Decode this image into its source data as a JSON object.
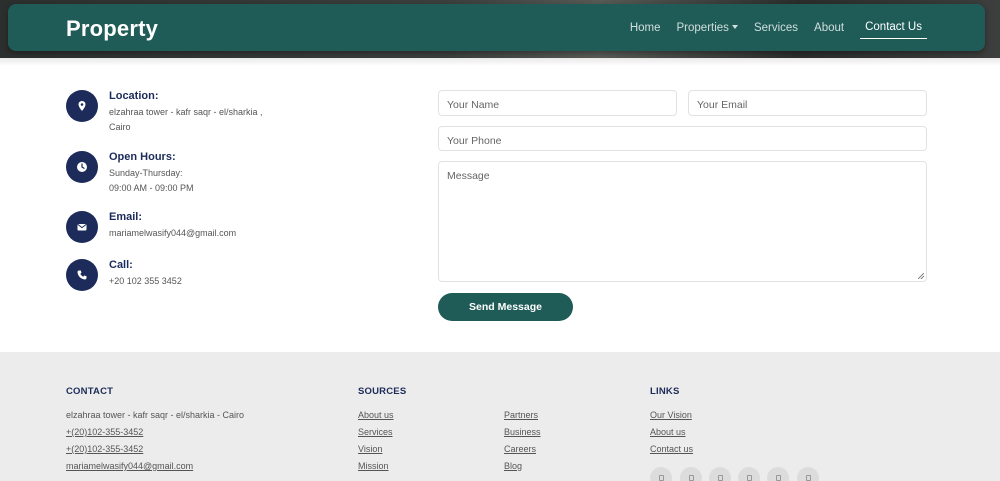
{
  "navbar": {
    "brand": "Property",
    "links": [
      {
        "label": "Home"
      },
      {
        "label": "Properties"
      },
      {
        "label": "Services"
      },
      {
        "label": "About"
      },
      {
        "label": "Contact Us"
      }
    ]
  },
  "contact_info": [
    {
      "icon": "location-pin-icon",
      "title": "Location:",
      "lines": [
        "elzahraa tower - kafr saqr - el/sharkia ,",
        "Cairo"
      ]
    },
    {
      "icon": "clock-icon",
      "title": "Open Hours:",
      "lines": [
        "Sunday-Thursday:",
        "09:00 AM - 09:00 PM"
      ]
    },
    {
      "icon": "envelope-icon",
      "title": "Email:",
      "lines": [
        "mariamelwasify044@gmail.com"
      ]
    },
    {
      "icon": "phone-icon",
      "title": "Call:",
      "lines": [
        "+20 102 355 3452"
      ]
    }
  ],
  "form": {
    "name_placeholder": "Your Name",
    "email_placeholder": "Your Email",
    "phone_placeholder": "Your Phone",
    "message_placeholder": "Message",
    "submit_label": "Send Message"
  },
  "footer": {
    "contact": {
      "heading": "CONTACT",
      "address": "elzahraa tower - kafr saqr - el/sharkia - Cairo",
      "phone1": "+(20)102-355-3452",
      "phone2": "+(20)102-355-3452",
      "email": "mariamelwasify044@gmail.com"
    },
    "sources": {
      "heading": "SOURCES",
      "col1": [
        "About us",
        "Services",
        "Vision",
        "Mission"
      ],
      "col2": [
        "Partners",
        "Business",
        "Careers",
        "Blog"
      ]
    },
    "links": {
      "heading": "LINKS",
      "items": [
        "Our Vision",
        "About us",
        "Contact us"
      ]
    }
  },
  "colors": {
    "brand_green": "#1f5c58",
    "navy": "#1c2b5a",
    "footer_bg": "#ececec"
  }
}
